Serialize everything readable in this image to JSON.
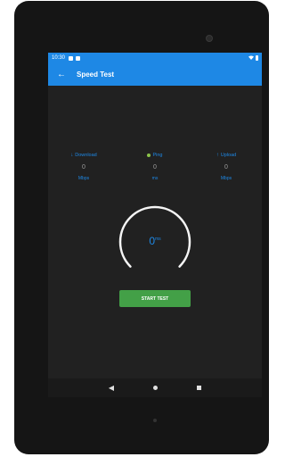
{
  "status_bar": {
    "time": "10:30"
  },
  "app_bar": {
    "title": "Speed Test",
    "back_icon": "arrow-back-icon"
  },
  "stats": [
    {
      "label": "Download",
      "icon": "arrow-down-icon",
      "value": "0",
      "unit": "Mbps"
    },
    {
      "label": "Ping",
      "icon": "dot-icon",
      "value": "0",
      "unit": "ms"
    },
    {
      "label": "Upload",
      "icon": "arrow-up-icon",
      "value": "0",
      "unit": "Mbps"
    }
  ],
  "gauge": {
    "value": "0",
    "unit": "ms"
  },
  "start_button": {
    "label": "START TEST"
  },
  "colors": {
    "accent": "#1e88e5",
    "button": "#43a047",
    "ping_dot": "#8bc34a",
    "background": "#212121"
  }
}
